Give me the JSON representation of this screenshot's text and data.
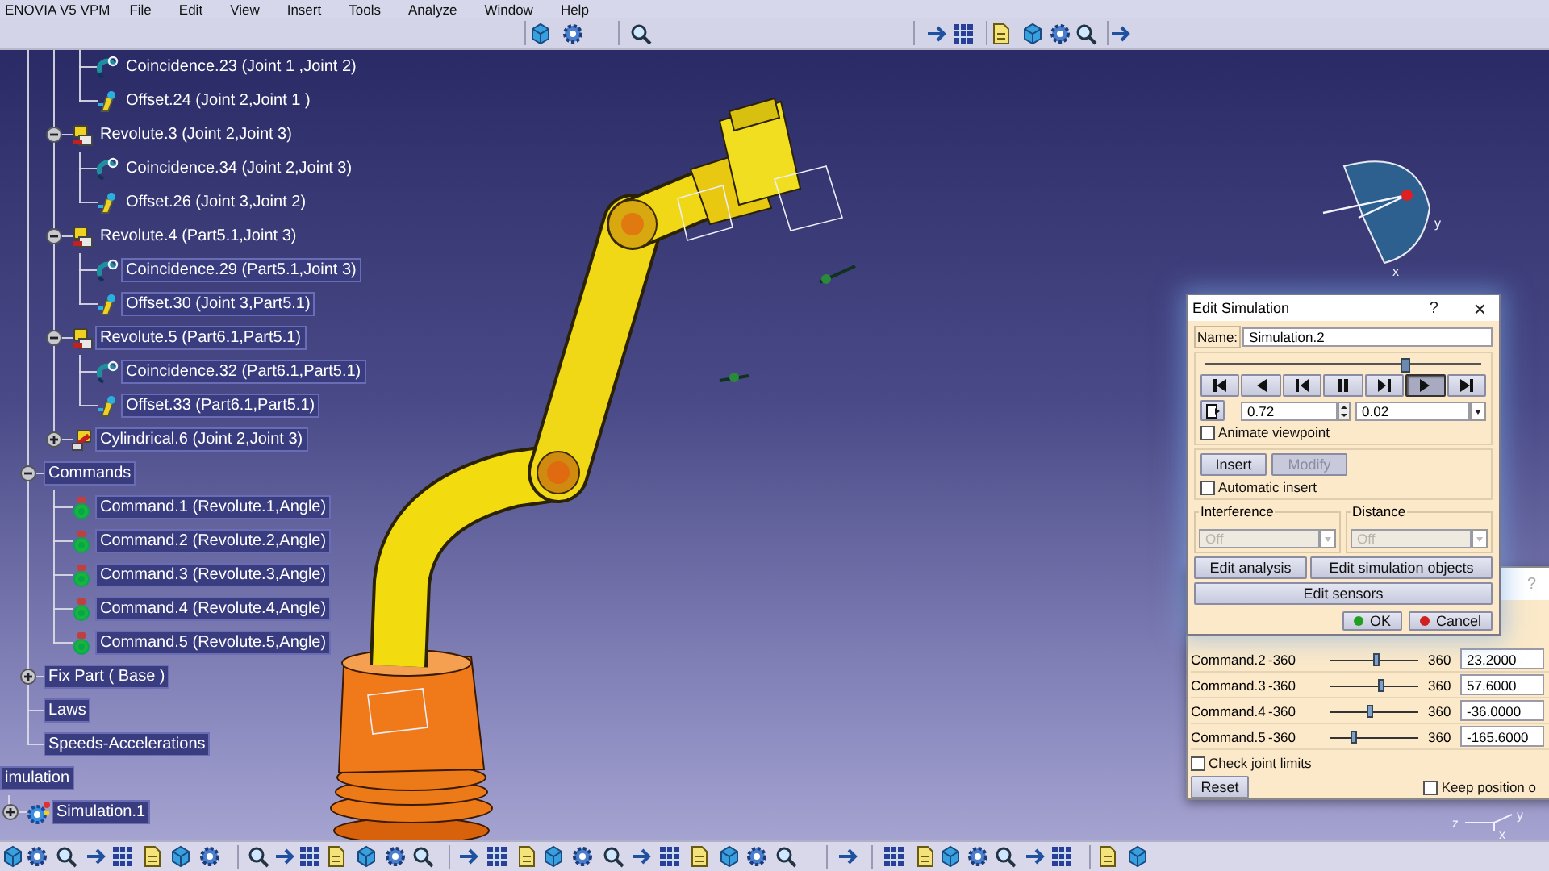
{
  "app": {
    "title": "ENOVIA V5 VPM"
  },
  "menu": [
    "File",
    "Edit",
    "View",
    "Insert",
    "Tools",
    "Analyze",
    "Window",
    "Help"
  ],
  "tree": {
    "continued_rows": [
      {
        "label": "Coincidence.23 (Joint 1 ,Joint 2)",
        "kind": "coincidence",
        "selected": false
      },
      {
        "label": "Offset.24 (Joint 2,Joint 1 )",
        "kind": "offset",
        "selected": false
      }
    ],
    "joints": [
      {
        "label": "Revolute.3 (Joint 2,Joint 3)",
        "kind": "revolute",
        "selected": false,
        "expanded": true,
        "children": [
          {
            "label": "Coincidence.34 (Joint 2,Joint 3)",
            "kind": "coincidence",
            "selected": false
          },
          {
            "label": "Offset.26 (Joint 3,Joint 2)",
            "kind": "offset",
            "selected": false
          }
        ]
      },
      {
        "label": "Revolute.4 (Part5.1,Joint 3)",
        "kind": "revolute",
        "selected": false,
        "expanded": true,
        "children": [
          {
            "label": "Coincidence.29 (Part5.1,Joint 3)",
            "kind": "coincidence",
            "selected": true
          },
          {
            "label": "Offset.30 (Joint 3,Part5.1)",
            "kind": "offset",
            "selected": true
          }
        ]
      },
      {
        "label": "Revolute.5 (Part6.1,Part5.1)",
        "kind": "revolute",
        "selected": true,
        "expanded": true,
        "children": [
          {
            "label": "Coincidence.32 (Part6.1,Part5.1)",
            "kind": "coincidence",
            "selected": true
          },
          {
            "label": "Offset.33 (Part6.1,Part5.1)",
            "kind": "offset",
            "selected": true
          }
        ]
      },
      {
        "label": "Cylindrical.6 (Joint 2,Joint 3)",
        "kind": "cylindrical",
        "selected": true,
        "expanded": false
      }
    ],
    "mechanism_items": [
      {
        "label": "Commands",
        "selected": true,
        "expanded": true,
        "children": [
          {
            "label": "Command.1 (Revolute.1,Angle)",
            "kind": "command",
            "selected": true
          },
          {
            "label": "Command.2 (Revolute.2,Angle)",
            "kind": "command",
            "selected": true
          },
          {
            "label": "Command.3 (Revolute.3,Angle)",
            "kind": "command",
            "selected": true
          },
          {
            "label": "Command.4 (Revolute.4,Angle)",
            "kind": "command",
            "selected": true
          },
          {
            "label": "Command.5 (Revolute.5,Angle)",
            "kind": "command",
            "selected": true
          }
        ]
      },
      {
        "label": "Fix Part ( Base )",
        "selected": true,
        "expanded": false
      },
      {
        "label": "Laws",
        "selected": true
      },
      {
        "label": "Speeds-Accelerations",
        "selected": true
      }
    ],
    "applications": [
      {
        "label": "imulation",
        "selected": true,
        "children": [
          {
            "label": "Simulation.1",
            "kind": "simulation",
            "selected": true,
            "expanded": false
          }
        ]
      }
    ]
  },
  "compass_labels": [
    "y",
    "x"
  ],
  "axis_labels": [
    "z",
    "y",
    "x"
  ],
  "edit_simulation": {
    "title": "Edit Simulation",
    "help": "?",
    "close": "×",
    "name_label": "Name:",
    "name_value": "Simulation.2",
    "timeline": {
      "level": 0.72
    },
    "player_buttons": [
      {
        "kind": "skip-start",
        "selected": false
      },
      {
        "kind": "step-back",
        "selected": false
      },
      {
        "kind": "previous",
        "selected": false
      },
      {
        "kind": "pause",
        "selected": false
      },
      {
        "kind": "next",
        "selected": false
      },
      {
        "kind": "play",
        "selected": true
      },
      {
        "kind": "skip-end",
        "selected": false
      }
    ],
    "step_value": "0.72",
    "step_size": "0.02",
    "animate_viewpoint": {
      "label": "Animate viewpoint",
      "checked": false
    },
    "insert": {
      "label": "Insert",
      "disabled": false
    },
    "modify": {
      "label": "Modify",
      "disabled": true
    },
    "automatic_insert": {
      "label": "Automatic insert",
      "checked": false
    },
    "interference": {
      "label": "Interference",
      "value": "Off",
      "disabled": true
    },
    "distance": {
      "label": "Distance",
      "value": "Off",
      "disabled": true
    },
    "buttons": [
      {
        "label": "Edit analysis"
      },
      {
        "label": "Edit simulation objects"
      },
      {
        "label": "Edit sensors"
      }
    ],
    "ok": "OK",
    "cancel": "Cancel"
  },
  "kinematics_panel": {
    "help": "?",
    "commands": [
      {
        "name": "Command.2",
        "min": "-360",
        "level": 0.53,
        "max": "360",
        "value": "23.2000"
      },
      {
        "name": "Command.3",
        "min": "-360",
        "level": 0.58,
        "max": "360",
        "value": "57.6000"
      },
      {
        "name": "Command.4",
        "min": "-360",
        "level": 0.45,
        "max": "360",
        "value": "-36.0000"
      },
      {
        "name": "Command.5",
        "min": "-360",
        "level": 0.27,
        "max": "360",
        "value": "-165.6000"
      }
    ],
    "check_joint_limits": {
      "label": "Check joint limits",
      "checked": false
    },
    "reset": "Reset",
    "keep_position": {
      "label": "Keep position o",
      "checked": false
    }
  }
}
